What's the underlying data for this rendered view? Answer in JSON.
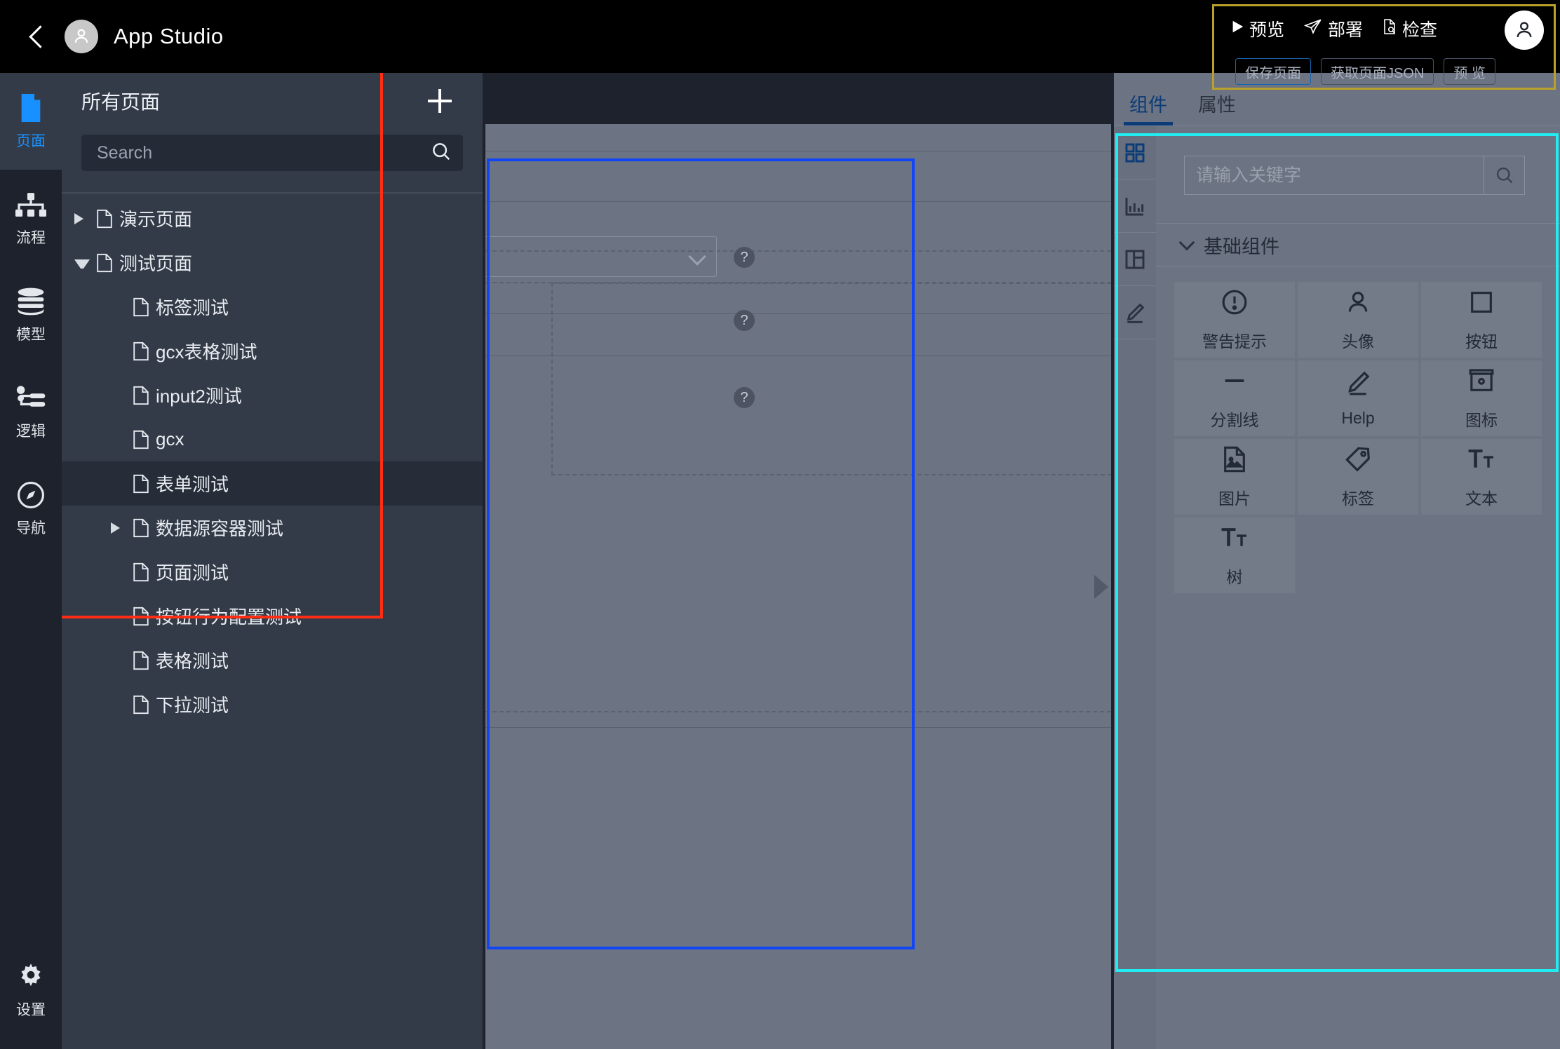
{
  "topbar": {
    "back_icon": "chevron-left-icon",
    "avatar_icon": "user-avatar-icon",
    "title": "App Studio",
    "actions": [
      {
        "label": "预览",
        "icon": "play-icon"
      },
      {
        "label": "部署",
        "icon": "paper-plane-icon"
      },
      {
        "label": "检查",
        "icon": "document-search-icon"
      }
    ],
    "user_avatar_icon": "user-avatar-icon",
    "buttons": [
      {
        "label": "保存页面",
        "primary": true
      },
      {
        "label": "获取页面JSON",
        "primary": false
      },
      {
        "label": "预 览",
        "primary": false
      }
    ]
  },
  "rail": {
    "items": [
      {
        "label": "页面",
        "icon": "page-icon",
        "active": true
      },
      {
        "label": "流程",
        "icon": "flow-icon",
        "active": false
      },
      {
        "label": "模型",
        "icon": "database-icon",
        "active": false
      },
      {
        "label": "逻辑",
        "icon": "logic-icon",
        "active": false
      },
      {
        "label": "导航",
        "icon": "compass-icon",
        "active": false
      }
    ],
    "settings": {
      "label": "设置",
      "icon": "gear-icon"
    }
  },
  "tree": {
    "title": "所有页面",
    "add_icon": "plus-icon",
    "search": {
      "value": "",
      "placeholder": "Search",
      "icon": "search-icon"
    },
    "items": [
      {
        "label": "演示页面",
        "level": 0,
        "caret": "right",
        "selected": false
      },
      {
        "label": "测试页面",
        "level": 0,
        "caret": "down",
        "selected": false
      },
      {
        "label": "标签测试",
        "level": 1,
        "caret": "none",
        "selected": false
      },
      {
        "label": "gcx表格测试",
        "level": 1,
        "caret": "none",
        "selected": false
      },
      {
        "label": "input2测试",
        "level": 1,
        "caret": "none",
        "selected": false
      },
      {
        "label": "gcx",
        "level": 1,
        "caret": "none",
        "selected": false
      },
      {
        "label": "表单测试",
        "level": 1,
        "caret": "none",
        "selected": true
      },
      {
        "label": "数据源容器测试",
        "level": 1,
        "caret": "right",
        "selected": false
      },
      {
        "label": "页面测试",
        "level": 1,
        "caret": "none",
        "selected": false
      },
      {
        "label": "按钮行为配置测试",
        "level": 1,
        "caret": "none",
        "selected": false
      },
      {
        "label": "表格测试",
        "level": 1,
        "caret": "none",
        "selected": false
      },
      {
        "label": "下拉测试",
        "level": 1,
        "caret": "none",
        "selected": false
      }
    ]
  },
  "canvas": {
    "select_value": "",
    "help_icon": "question-mark-icon",
    "collapse_icon": "triangle-right-icon"
  },
  "right_panel": {
    "tabs": [
      {
        "label": "组件",
        "active": true
      },
      {
        "label": "属性",
        "active": false
      }
    ],
    "icon_rail": [
      {
        "icon": "grid-icon",
        "active": true
      },
      {
        "icon": "chart-icon",
        "active": false
      },
      {
        "icon": "layout-icon",
        "active": false
      },
      {
        "icon": "pencil-icon",
        "active": false
      }
    ],
    "search": {
      "value": "",
      "placeholder": "请输入关键字",
      "icon": "search-icon"
    },
    "group_title": "基础组件",
    "group_chevron": "chevron-down-icon",
    "components": [
      {
        "label": "警告提示",
        "icon": "alert-circle-icon"
      },
      {
        "label": "头像",
        "icon": "user-icon"
      },
      {
        "label": "按钮",
        "icon": "square-icon"
      },
      {
        "label": "分割线",
        "icon": "divider-icon"
      },
      {
        "label": "Help",
        "icon": "pencil-icon"
      },
      {
        "label": "图标",
        "icon": "archive-icon"
      },
      {
        "label": "图片",
        "icon": "image-icon"
      },
      {
        "label": "标签",
        "icon": "tag-icon"
      },
      {
        "label": "文本",
        "icon": "text-icon"
      },
      {
        "label": "树",
        "icon": "text-tree-icon"
      }
    ]
  },
  "highlights": {
    "tree_border": "#ff2d13",
    "canvas_border": "#1145f5",
    "panel_border": "#22ecf1",
    "toolbar_border": "#b9a12c"
  }
}
